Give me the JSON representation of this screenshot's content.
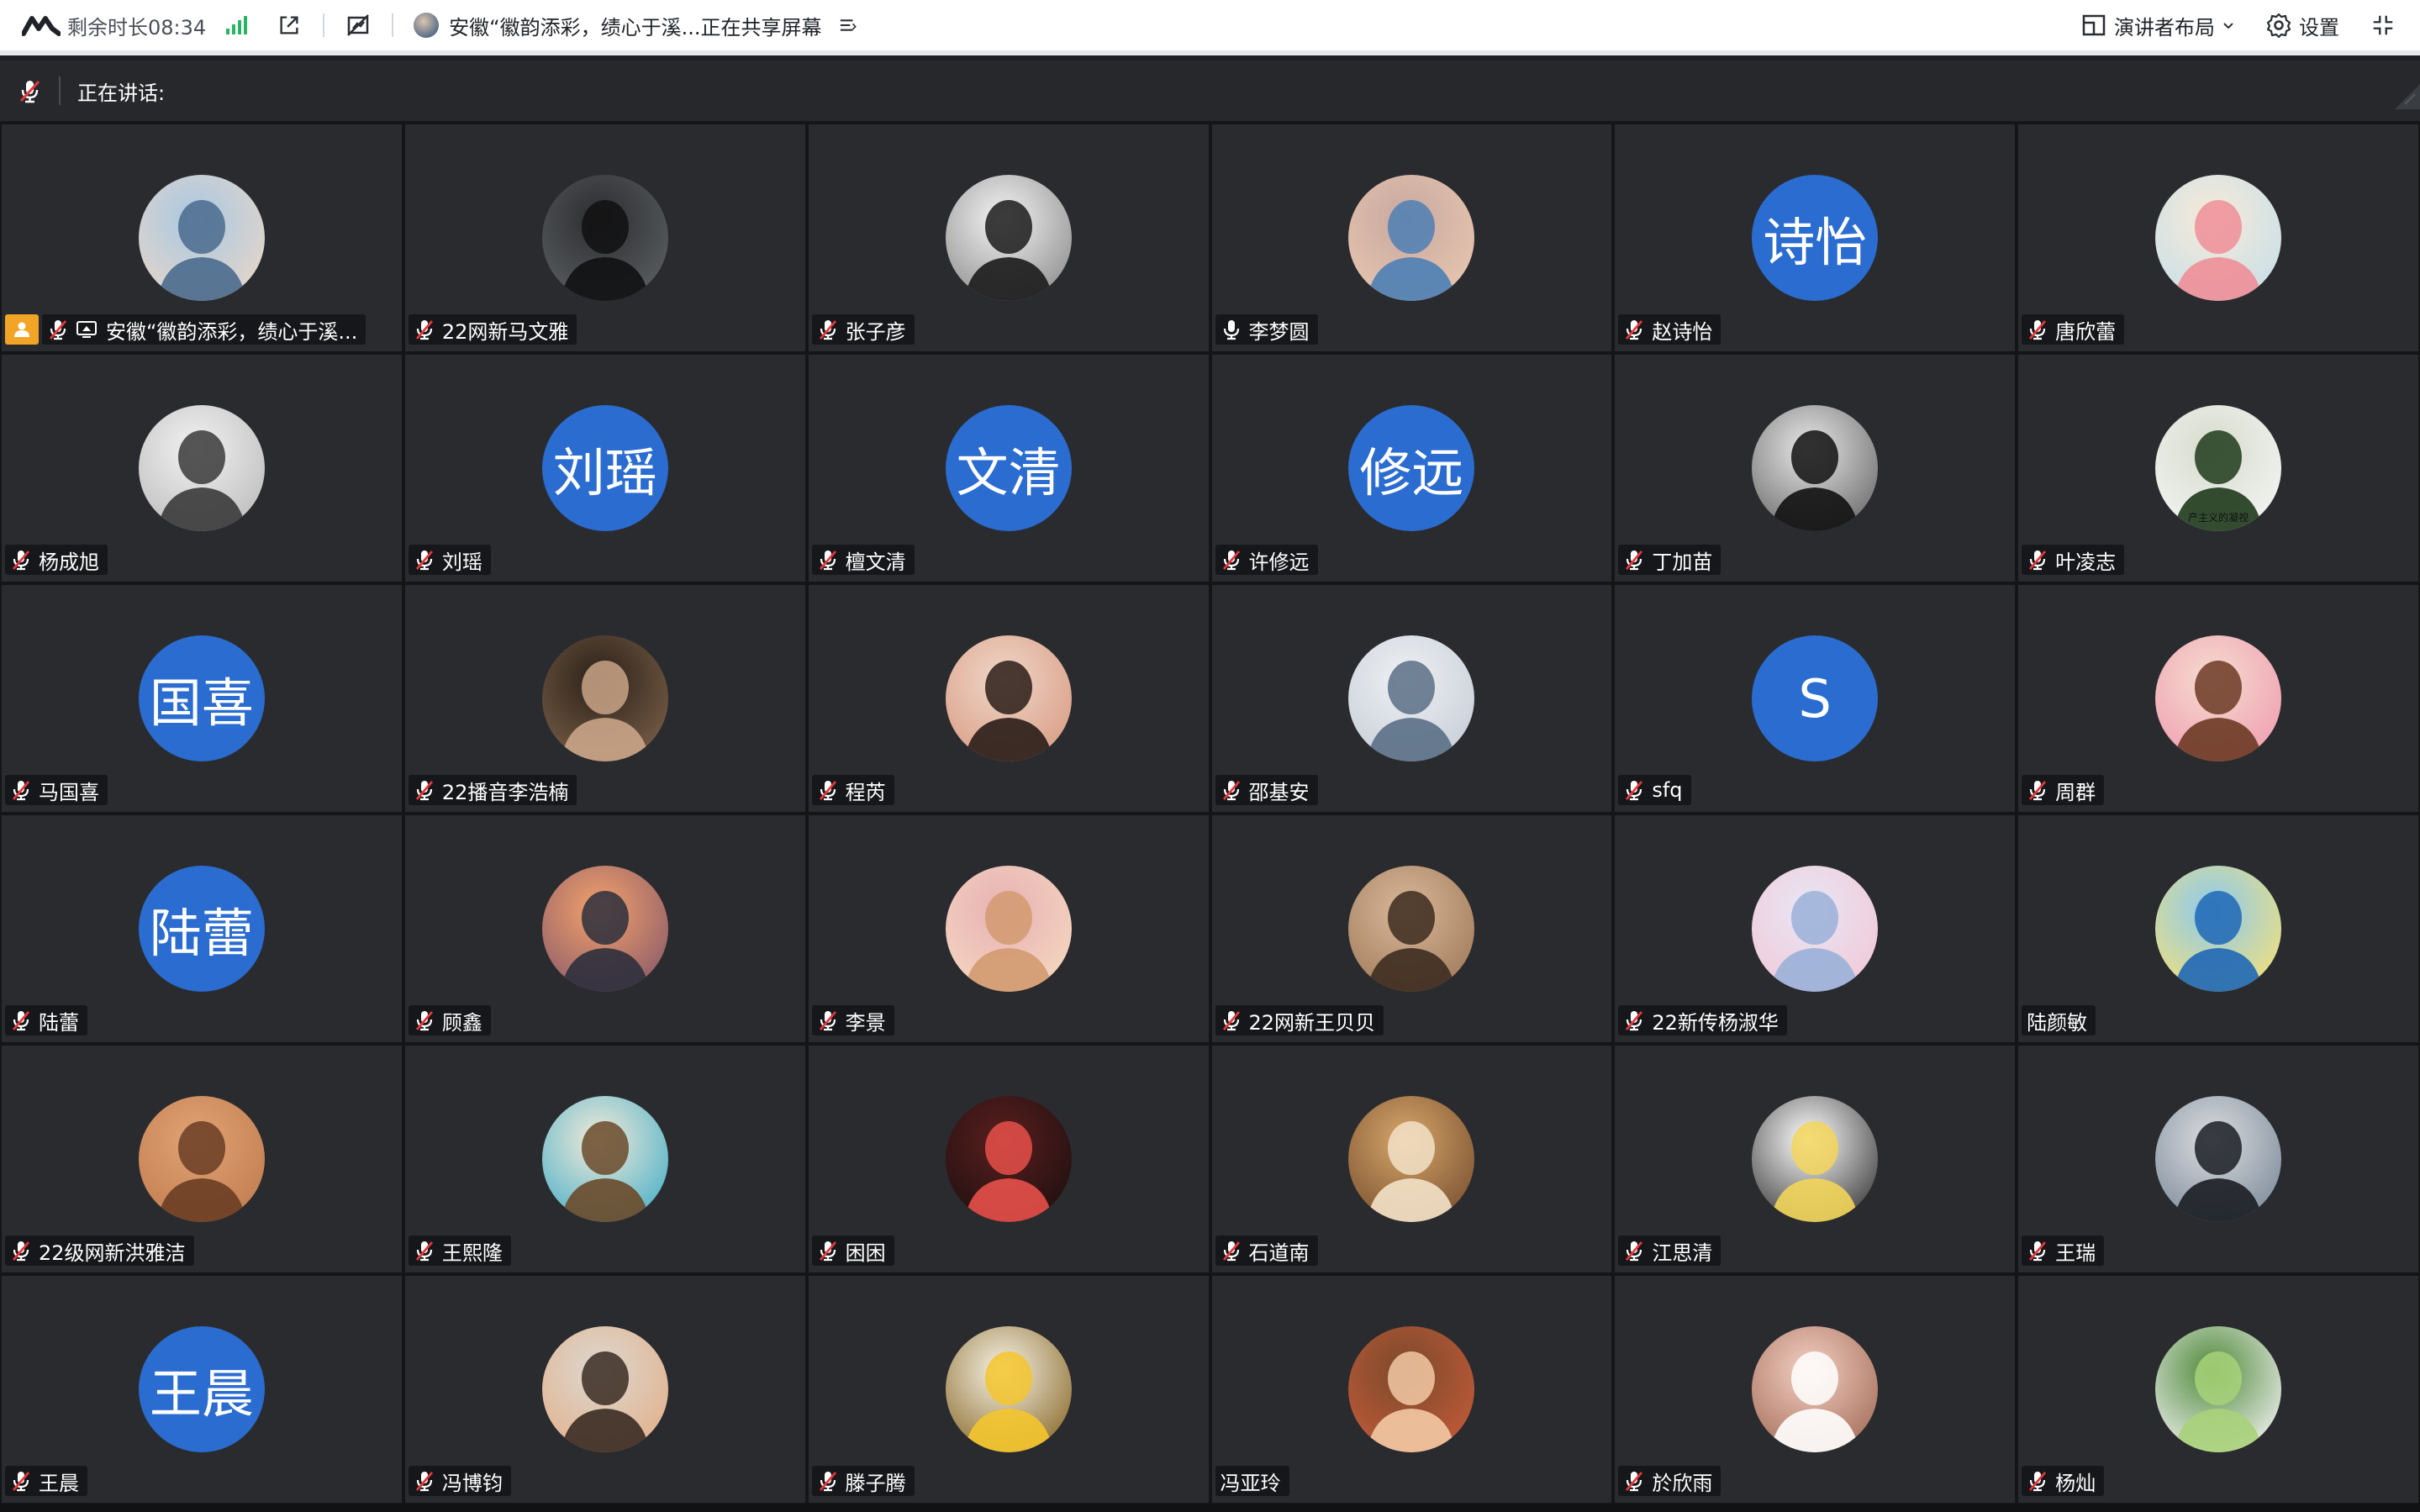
{
  "toolbar": {
    "remaining_label": "剩余时长08:34",
    "share_info": "安徽“徽韵添彩，绩心于溪...正在共享屏幕",
    "layout_label": "演讲者布局",
    "settings_label": "设置",
    "signal_color": "#28b463"
  },
  "speaking": {
    "label": "正在讲话:"
  },
  "participants": [
    {
      "name": "安徽“徽韵添彩，绩心于溪...",
      "avatar": "photo",
      "colors": [
        "#a9c8e2",
        "#4a6a8d",
        "#e8d6c8"
      ],
      "mic": "muted",
      "host": true
    },
    {
      "name": "22网新马文雅",
      "avatar": "photo",
      "colors": [
        "#2b2d2f",
        "#101112",
        "#5c5f63"
      ],
      "mic": "muted"
    },
    {
      "name": "张子彦",
      "avatar": "photo",
      "colors": [
        "#f4f4f4",
        "#1b1b1b",
        "#8d8d8d"
      ],
      "mic": "muted"
    },
    {
      "name": "李梦圆",
      "avatar": "photo",
      "colors": [
        "#c8a8a0",
        "#4d7fb5",
        "#e8c7b0"
      ],
      "mic": "on"
    },
    {
      "name": "赵诗怡",
      "avatar": "text",
      "initials": "诗怡",
      "mic": "muted"
    },
    {
      "name": "唐欣蕾",
      "avatar": "photo",
      "colors": [
        "#f7ead8",
        "#ee8e98",
        "#c7dfe9"
      ],
      "mic": "muted"
    },
    {
      "name": "杨成旭",
      "avatar": "photo",
      "colors": [
        "#f2f2f2",
        "#3a3a3a",
        "#bcbcbc"
      ],
      "mic": "muted"
    },
    {
      "name": "刘瑶",
      "avatar": "text",
      "initials": "刘瑶",
      "mic": "muted"
    },
    {
      "name": "檀文清",
      "avatar": "text",
      "initials": "文清",
      "mic": "muted"
    },
    {
      "name": "许修远",
      "avatar": "text",
      "initials": "修远",
      "mic": "muted"
    },
    {
      "name": "丁加苗",
      "avatar": "photo",
      "colors": [
        "#e8e8e8",
        "#111111",
        "#6a6a6a"
      ],
      "mic": "muted"
    },
    {
      "name": "叶凌志",
      "avatar": "photo",
      "colors": [
        "#d6dccc",
        "#1e3a1b",
        "#f4f4f4"
      ],
      "mic": "muted",
      "caption": "产主义的凝视"
    },
    {
      "name": "马国喜",
      "avatar": "text",
      "initials": "国喜",
      "mic": "muted"
    },
    {
      "name": "22播音李浩楠",
      "avatar": "photo",
      "colors": [
        "#2a2118",
        "#caa488",
        "#7a5f48"
      ],
      "mic": "muted"
    },
    {
      "name": "程芮",
      "avatar": "photo",
      "colors": [
        "#f0d6c8",
        "#2a1d18",
        "#d89c84"
      ],
      "mic": "muted"
    },
    {
      "name": "邵基安",
      "avatar": "photo",
      "colors": [
        "#eef0f3",
        "#5a6f86",
        "#c7ced8"
      ],
      "mic": "muted"
    },
    {
      "name": "sfq",
      "avatar": "text",
      "initials": "S",
      "mic": "muted"
    },
    {
      "name": "周群",
      "avatar": "photo",
      "colors": [
        "#f5dccf",
        "#6b3a24",
        "#f09db1"
      ],
      "mic": "muted"
    },
    {
      "name": "陆蕾",
      "avatar": "text",
      "initials": "陆蕾",
      "mic": "muted"
    },
    {
      "name": "顾鑫",
      "avatar": "photo",
      "colors": [
        "#f3a26b",
        "#2d2f3d",
        "#8a5a6a"
      ],
      "mic": "muted"
    },
    {
      "name": "李景",
      "avatar": "photo",
      "colors": [
        "#e7b1b4",
        "#d29a70",
        "#f5d8c0"
      ],
      "mic": "muted"
    },
    {
      "name": "22网新王贝贝",
      "avatar": "photo",
      "colors": [
        "#d8b899",
        "#3d2c20",
        "#a07a5a"
      ],
      "mic": "muted"
    },
    {
      "name": "22新传杨淑华",
      "avatar": "photo",
      "colors": [
        "#e8e6f5",
        "#9ab0d8",
        "#f2c8d6"
      ],
      "mic": "muted"
    },
    {
      "name": "陆颜敏",
      "avatar": "photo",
      "colors": [
        "#8cc9ef",
        "#1f67b5",
        "#f3e17a"
      ],
      "mic": "none"
    },
    {
      "name": "22级网新洪雅洁",
      "avatar": "photo",
      "colors": [
        "#e2a374",
        "#6a3d24",
        "#c07c50"
      ],
      "mic": "muted"
    },
    {
      "name": "王熙隆",
      "avatar": "photo",
      "colors": [
        "#f3ead8",
        "#6a4a2a",
        "#49b0c9"
      ],
      "mic": "muted"
    },
    {
      "name": "困困",
      "avatar": "photo",
      "colors": [
        "#5a1e1e",
        "#e8504a",
        "#1e1010"
      ],
      "mic": "muted"
    },
    {
      "name": "石道南",
      "avatar": "photo",
      "colors": [
        "#d6a66a",
        "#f3e2c8",
        "#7a5030"
      ],
      "mic": "muted"
    },
    {
      "name": "江思清",
      "avatar": "photo",
      "colors": [
        "#ffffff",
        "#f2d55a",
        "#3a3a3a"
      ],
      "mic": "muted"
    },
    {
      "name": "王瑞",
      "avatar": "photo",
      "colors": [
        "#dcdde0",
        "#1b1e24",
        "#7b8a9a"
      ],
      "mic": "muted"
    },
    {
      "name": "王晨",
      "avatar": "text",
      "initials": "王晨",
      "mic": "muted"
    },
    {
      "name": "冯博钧",
      "avatar": "photo",
      "colors": [
        "#dcd8cf",
        "#3a2b22",
        "#e3b08b"
      ],
      "mic": "muted"
    },
    {
      "name": "滕子腾",
      "avatar": "photo",
      "colors": [
        "#f6f2e6",
        "#f3c52e",
        "#8a6a2a"
      ],
      "mic": "muted"
    },
    {
      "name": "冯亚玲",
      "avatar": "photo",
      "colors": [
        "#7a4a2a",
        "#f3c9a4",
        "#c45a3a"
      ],
      "mic": "none"
    },
    {
      "name": "於欣雨",
      "avatar": "photo",
      "colors": [
        "#f3d0c2",
        "#ffffff",
        "#a46c5a"
      ],
      "mic": "muted"
    },
    {
      "name": "杨灿",
      "avatar": "photo",
      "colors": [
        "#4f8a3a",
        "#a8d27a",
        "#f2f2f2"
      ],
      "mic": "muted"
    }
  ]
}
